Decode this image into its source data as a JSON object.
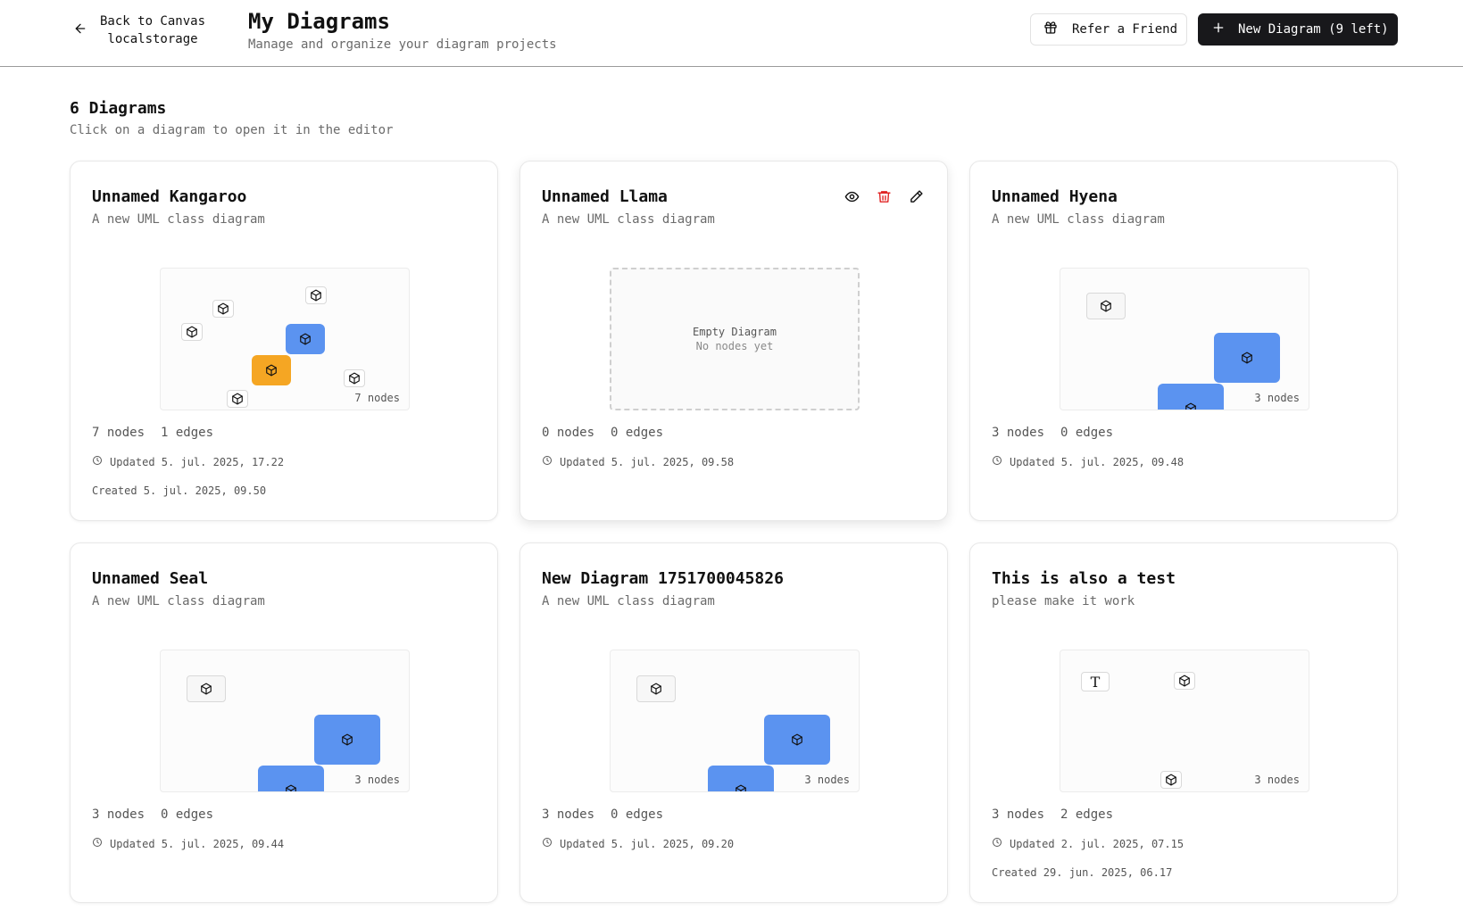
{
  "header": {
    "back_label": "Back to Canvas",
    "back_sub": "localstorage",
    "title": "My Diagrams",
    "subtitle": "Manage and organize your diagram projects",
    "refer_label": "Refer a Friend",
    "new_label": "New Diagram (9 left)"
  },
  "section": {
    "title": "6 Diagrams",
    "subtitle": "Click on a diagram to open it in the editor"
  },
  "icons": {
    "back": "arrow-left-icon",
    "refer": "gift-icon",
    "new": "plus-icon",
    "node": "cube-icon",
    "view": "eye-icon",
    "delete": "trash-icon",
    "edit": "pencil-icon",
    "updated": "clock-icon"
  },
  "colors": {
    "primary_button": "#18181b",
    "node_blue": "#5b93f0",
    "node_orange": "#f5a623",
    "delete": "#e02424"
  },
  "cards": [
    {
      "title": "Unnamed Kangaroo",
      "description": "A new UML class diagram",
      "preview_count": "7 nodes",
      "nodes_stat": "7 nodes",
      "edges_stat": "1 edges",
      "updated": "Updated 5. jul. 2025, 17.22",
      "created": "Created 5. jul. 2025, 09.50"
    },
    {
      "title": "Unnamed Llama",
      "description": "A new UML class diagram",
      "empty_title": "Empty Diagram",
      "empty_sub": "No nodes yet",
      "nodes_stat": "0 nodes",
      "edges_stat": "0 edges",
      "updated": "Updated 5. jul. 2025, 09.58"
    },
    {
      "title": "Unnamed Hyena",
      "description": "A new UML class diagram",
      "preview_count": "3 nodes",
      "nodes_stat": "3 nodes",
      "edges_stat": "0 edges",
      "updated": "Updated 5. jul. 2025, 09.48"
    },
    {
      "title": "Unnamed Seal",
      "description": "A new UML class diagram",
      "preview_count": "3 nodes",
      "nodes_stat": "3 nodes",
      "edges_stat": "0 edges",
      "updated": "Updated 5. jul. 2025, 09.44"
    },
    {
      "title": "New Diagram 1751700045826",
      "description": "A new UML class diagram",
      "preview_count": "3 nodes",
      "nodes_stat": "3 nodes",
      "edges_stat": "0 edges",
      "updated": "Updated 5. jul. 2025, 09.20"
    },
    {
      "title": "This is also a test",
      "description": "please make it work",
      "preview_count": "3 nodes",
      "text_node_glyph": "T",
      "nodes_stat": "3 nodes",
      "edges_stat": "2 edges",
      "updated": "Updated 2. jul. 2025, 07.15",
      "created": "Created 29. jun. 2025, 06.17"
    }
  ]
}
